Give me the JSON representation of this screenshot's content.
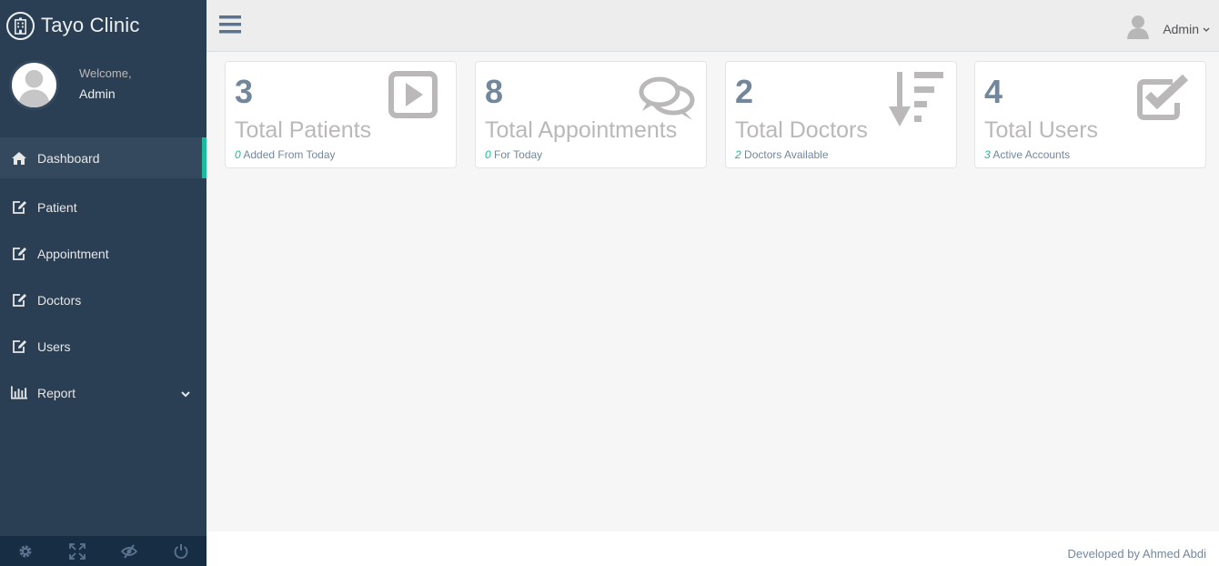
{
  "brand": {
    "name": "Tayo Clinic",
    "icon": "hospital-icon"
  },
  "profile": {
    "welcome": "Welcome,",
    "name": "Admin"
  },
  "menu": [
    {
      "label": "Dashboard",
      "icon": "home-icon",
      "active": true
    },
    {
      "label": "Patient",
      "icon": "edit-icon"
    },
    {
      "label": "Appointment",
      "icon": "edit-icon"
    },
    {
      "label": "Doctors",
      "icon": "edit-icon"
    },
    {
      "label": "Users",
      "icon": "edit-icon"
    },
    {
      "label": "Report",
      "icon": "bar-chart-icon",
      "has_submenu": true
    }
  ],
  "sidebar_footer": [
    "settings-icon",
    "fullscreen-icon",
    "lock-icon",
    "logout-icon"
  ],
  "topnav": {
    "user": "Admin"
  },
  "tiles": [
    {
      "count": "3",
      "title": "Total Patients",
      "sub_value": "0",
      "sub_text": " Added From Today",
      "icon": "play-square-icon"
    },
    {
      "count": "8",
      "title": "Total Appointments",
      "sub_value": "0",
      "sub_text": " For Today",
      "icon": "comments-icon"
    },
    {
      "count": "2",
      "title": "Total Doctors",
      "sub_value": "2",
      "sub_text": " Doctors Available",
      "icon": "sort-amount-desc-icon"
    },
    {
      "count": "4",
      "title": "Total Users",
      "sub_value": "3",
      "sub_text": " Active Accounts",
      "icon": "check-square-icon"
    }
  ],
  "footer": {
    "text": "Developed by Ahmed Abdi"
  },
  "colors": {
    "sidebar": "#2a3f54",
    "accent": "#1abb9c",
    "text_muted": "#73879c"
  }
}
